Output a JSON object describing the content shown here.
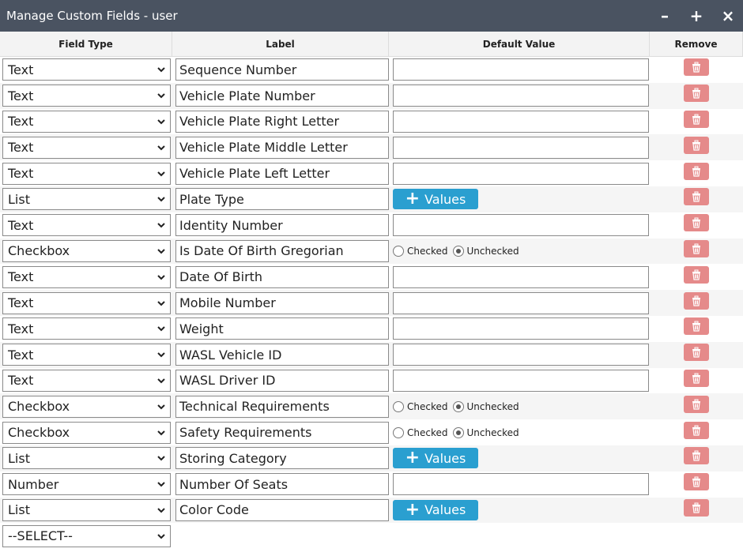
{
  "window": {
    "title": "Manage Custom Fields - user",
    "minimize": "–",
    "maximize": "+",
    "close": "×"
  },
  "columns": {
    "field_type": "Field Type",
    "label": "Label",
    "default_value": "Default Value",
    "remove": "Remove"
  },
  "radio_labels": {
    "checked": "Checked",
    "unchecked": "Unchecked"
  },
  "values_button": "Values",
  "rows": [
    {
      "type": "Text",
      "label": "Sequence Number",
      "default": "",
      "kind": "input"
    },
    {
      "type": "Text",
      "label": "Vehicle Plate Number",
      "default": "",
      "kind": "input"
    },
    {
      "type": "Text",
      "label": "Vehicle Plate Right Letter",
      "default": "",
      "kind": "input"
    },
    {
      "type": "Text",
      "label": "Vehicle Plate Middle Letter",
      "default": "",
      "kind": "input"
    },
    {
      "type": "Text",
      "label": "Vehicle Plate Left Letter",
      "default": "",
      "kind": "input"
    },
    {
      "type": "List",
      "label": "Plate Type",
      "default": "",
      "kind": "values"
    },
    {
      "type": "Text",
      "label": "Identity Number",
      "default": "",
      "kind": "input"
    },
    {
      "type": "Checkbox",
      "label": "Is Date Of Birth Gregorian",
      "default": "Unchecked",
      "kind": "radio"
    },
    {
      "type": "Text",
      "label": "Date Of Birth",
      "default": "",
      "kind": "input"
    },
    {
      "type": "Text",
      "label": "Mobile Number",
      "default": "",
      "kind": "input"
    },
    {
      "type": "Text",
      "label": "Weight",
      "default": "",
      "kind": "input"
    },
    {
      "type": "Text",
      "label": "WASL Vehicle ID",
      "default": "",
      "kind": "input"
    },
    {
      "type": "Text",
      "label": "WASL Driver ID",
      "default": "",
      "kind": "input"
    },
    {
      "type": "Checkbox",
      "label": "Technical Requirements",
      "default": "Unchecked",
      "kind": "radio"
    },
    {
      "type": "Checkbox",
      "label": "Safety Requirements",
      "default": "Unchecked",
      "kind": "radio"
    },
    {
      "type": "List",
      "label": "Storing Category",
      "default": "",
      "kind": "values"
    },
    {
      "type": "Number",
      "label": "Number Of Seats",
      "default": "",
      "kind": "input"
    },
    {
      "type": "List",
      "label": "Color Code",
      "default": "",
      "kind": "values"
    }
  ],
  "new_row": {
    "type": "--SELECT--"
  },
  "colors": {
    "titlebar": "#4a5361",
    "values_button": "#2a9fd0",
    "trash_button": "#e58a8a"
  }
}
